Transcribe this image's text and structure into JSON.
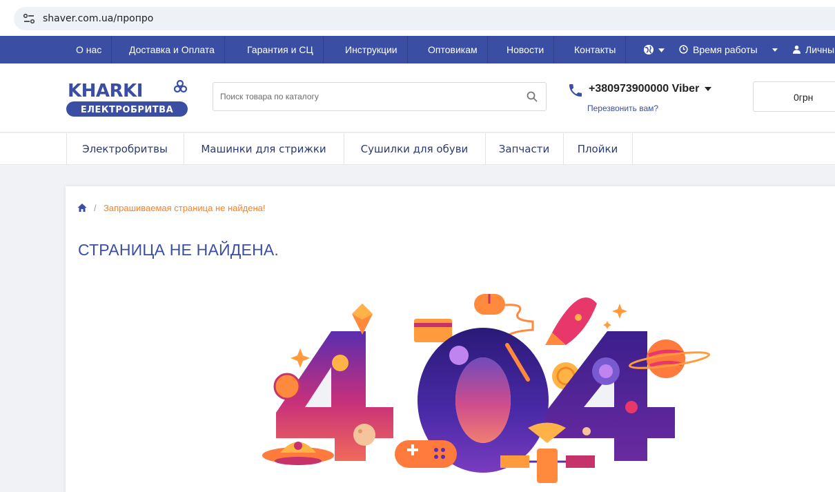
{
  "browser": {
    "url": "shaver.com.ua/пропро"
  },
  "topnav": {
    "items": [
      "О нас",
      "Доставка и Оплата",
      "Гарантия и СЦ",
      "Инструкции",
      "Оптовикам",
      "Новости",
      "Контакты"
    ],
    "work_hours": "Время работы",
    "account": "Личны"
  },
  "header": {
    "logo_top": "KHARKI",
    "logo_bottom": "ЕЛЕКТРОБРИТВА",
    "search_placeholder": "Поиск товара по каталогу",
    "phone": "+380973900000 Viber",
    "callback": "Перезвонить вам?",
    "cart_total": "0грн"
  },
  "categories": [
    "Электробритвы",
    "Машинки для стрижки",
    "Сушилки для обуви",
    "Запчасти",
    "Плойки"
  ],
  "breadcrumb": {
    "current": "Запрашиваемая страница не найдена!"
  },
  "page": {
    "title": "СТРАНИЦА НЕ НАЙДЕНА."
  },
  "illustration": {
    "digits": [
      "4",
      "0",
      "4"
    ]
  },
  "colors": {
    "brand_blue": "#3a4fa3",
    "accent_orange": "#ff7f1f",
    "illustration_purple": "#3b1f8c",
    "illustration_pink": "#e8376a"
  },
  "icons": [
    "site-info-icon",
    "globe-icon",
    "clock-icon",
    "user-icon",
    "search-icon",
    "phone-icon",
    "home-icon"
  ]
}
